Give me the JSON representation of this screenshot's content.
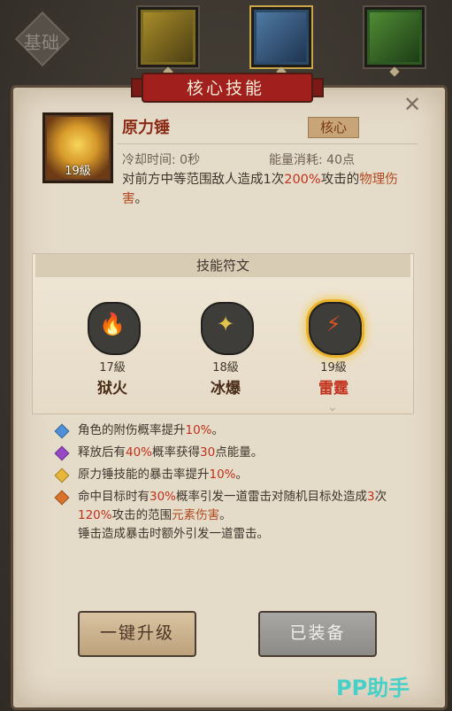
{
  "tabs": {
    "base_label": "基础"
  },
  "panel": {
    "title": "核心技能",
    "close_symbol": "✕"
  },
  "skill": {
    "name": "原力锤",
    "level": "19級",
    "badge": "核心",
    "cooldown": "冷却时间: 0秒",
    "energy": "能量消耗: 40点",
    "desc_pre": "对前方中等范围敌人造成1次",
    "desc_pct": "200%",
    "desc_mid": "攻击的",
    "desc_type": "物理伤害",
    "desc_end": "。"
  },
  "runes": {
    "title": "技能符文",
    "items": [
      {
        "level": "17級",
        "name": "狱火",
        "color": "#4a2d18"
      },
      {
        "level": "18級",
        "name": "冰爆",
        "color": "#4a2d18"
      },
      {
        "level": "19級",
        "name": "雷霆",
        "color": "#c1311c"
      }
    ]
  },
  "effects": {
    "e1_a": "角色的附伤概率提升",
    "e1_b": "10%",
    "e1_c": "。",
    "e2_a": "释放后有",
    "e2_b": "40%",
    "e2_c": "概率获得",
    "e2_d": "30",
    "e2_e": "点能量。",
    "e3_a": "原力锤技能的暴击率提升",
    "e3_b": "10%",
    "e3_c": "。",
    "e4_a": "命中目标时有",
    "e4_b": "30%",
    "e4_c": "概率引发一道雷击对随机目标处造成",
    "e4_d": "3",
    "e4_e": "次",
    "e4_f": "120%",
    "e4_g": "攻击的范围",
    "e4_h": "元素伤害",
    "e4_i": "。",
    "e4_j": "锤击造成暴击时额外引发一道雷击。"
  },
  "buttons": {
    "upgrade": "一键升级",
    "equipped": "已装备"
  },
  "watermark": "PP助手"
}
